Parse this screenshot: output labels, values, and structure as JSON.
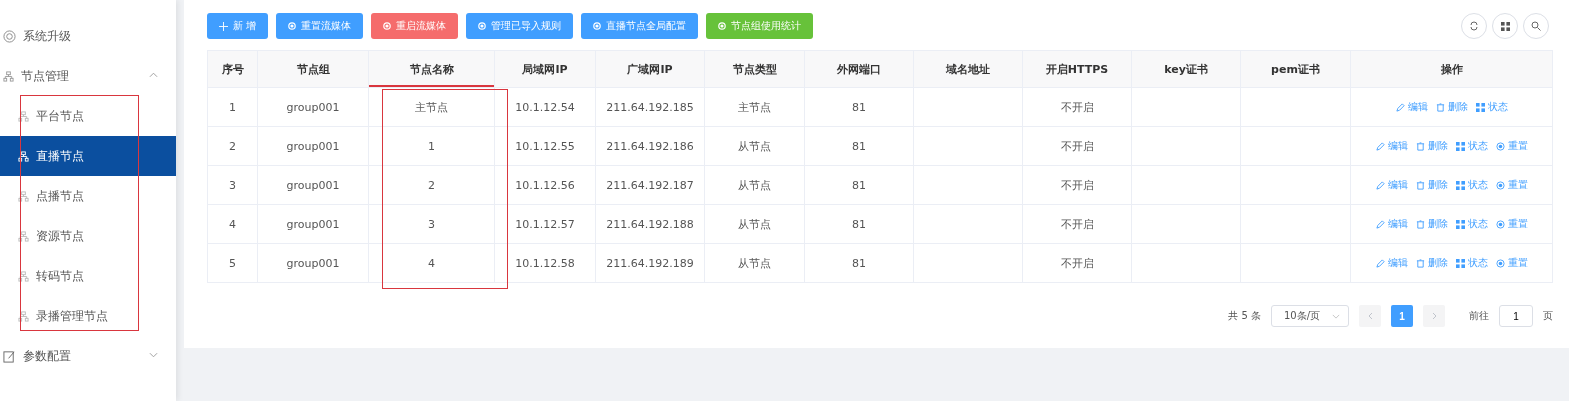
{
  "sidebar": {
    "items": [
      {
        "label": "系统升级"
      },
      {
        "label": "节点管理",
        "expanded": true,
        "highlighted": true,
        "children": [
          {
            "label": "平台节点",
            "selected": false
          },
          {
            "label": "直播节点",
            "selected": true
          },
          {
            "label": "点播节点",
            "selected": false
          },
          {
            "label": "资源节点",
            "selected": false
          },
          {
            "label": "转码节点",
            "selected": false
          },
          {
            "label": "录播管理节点",
            "selected": false
          }
        ]
      },
      {
        "label": "参数配置",
        "expanded": false
      }
    ]
  },
  "toolbar": {
    "buttons": [
      {
        "label": "新 增",
        "kind": "add",
        "color": "#409eff"
      },
      {
        "label": "重置流媒体",
        "kind": "action",
        "color": "#409eff"
      },
      {
        "label": "重启流媒体",
        "kind": "action",
        "color": "#f56c6c"
      },
      {
        "label": "管理已导入规则",
        "kind": "action",
        "color": "#409eff"
      },
      {
        "label": "直播节点全局配置",
        "kind": "action",
        "color": "#409eff"
      },
      {
        "label": "节点组使用统计",
        "kind": "action",
        "color": "#67c23a"
      }
    ]
  },
  "table": {
    "columns": [
      {
        "label": "序号",
        "highlighted": false
      },
      {
        "label": "节点组",
        "highlighted": false
      },
      {
        "label": "节点名称",
        "highlighted": true
      },
      {
        "label": "局域网IP",
        "highlighted": false
      },
      {
        "label": "广域网IP",
        "highlighted": false
      },
      {
        "label": "节点类型",
        "highlighted": false
      },
      {
        "label": "外网端口",
        "highlighted": false
      },
      {
        "label": "域名地址",
        "highlighted": false
      },
      {
        "label": "开启HTTPS",
        "highlighted": false
      },
      {
        "label": "key证书",
        "highlighted": false
      },
      {
        "label": "pem证书",
        "highlighted": false
      },
      {
        "label": "操作",
        "highlighted": false
      }
    ],
    "rows": [
      {
        "cells": [
          "1",
          "group001",
          "主节点",
          "10.1.12.54",
          "211.64.192.185",
          "主节点",
          "81",
          "",
          "不开启",
          "",
          ""
        ],
        "actions": [
          {
            "label": "编辑",
            "kind": "edit"
          },
          {
            "label": "删除",
            "kind": "delete"
          },
          {
            "label": "状态",
            "kind": "status"
          }
        ]
      },
      {
        "cells": [
          "2",
          "group001",
          "1",
          "10.1.12.55",
          "211.64.192.186",
          "从节点",
          "81",
          "",
          "不开启",
          "",
          ""
        ],
        "actions": [
          {
            "label": "编辑",
            "kind": "edit"
          },
          {
            "label": "删除",
            "kind": "delete"
          },
          {
            "label": "状态",
            "kind": "status"
          },
          {
            "label": "重置",
            "kind": "reset"
          }
        ]
      },
      {
        "cells": [
          "3",
          "group001",
          "2",
          "10.1.12.56",
          "211.64.192.187",
          "从节点",
          "81",
          "",
          "不开启",
          "",
          ""
        ],
        "actions": [
          {
            "label": "编辑",
            "kind": "edit"
          },
          {
            "label": "删除",
            "kind": "delete"
          },
          {
            "label": "状态",
            "kind": "status"
          },
          {
            "label": "重置",
            "kind": "reset"
          }
        ]
      },
      {
        "cells": [
          "4",
          "group001",
          "3",
          "10.1.12.57",
          "211.64.192.188",
          "从节点",
          "81",
          "",
          "不开启",
          "",
          ""
        ],
        "actions": [
          {
            "label": "编辑",
            "kind": "edit"
          },
          {
            "label": "删除",
            "kind": "delete"
          },
          {
            "label": "状态",
            "kind": "status"
          },
          {
            "label": "重置",
            "kind": "reset"
          }
        ]
      },
      {
        "cells": [
          "5",
          "group001",
          "4",
          "10.1.12.58",
          "211.64.192.189",
          "从节点",
          "81",
          "",
          "不开启",
          "",
          ""
        ],
        "actions": [
          {
            "label": "编辑",
            "kind": "edit"
          },
          {
            "label": "删除",
            "kind": "delete"
          },
          {
            "label": "状态",
            "kind": "status"
          },
          {
            "label": "重置",
            "kind": "reset"
          }
        ]
      }
    ]
  },
  "pagination": {
    "total": "共 5 条",
    "page_size": "10条/页",
    "pages": [
      {
        "label": "1",
        "selected": true
      }
    ],
    "goto_label": "前往",
    "goto_value": "1",
    "goto_suffix": "页"
  }
}
